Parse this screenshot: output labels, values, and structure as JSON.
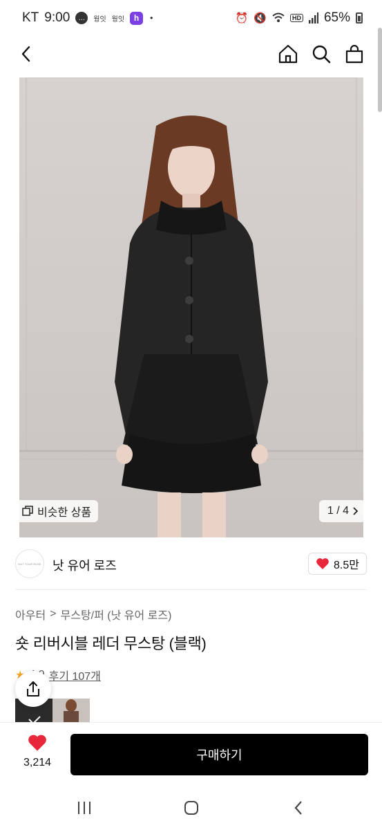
{
  "status_bar": {
    "carrier": "KT",
    "time": "9:00",
    "notif_text_1": "웡잇",
    "notif_text_2": "웡잇",
    "notif_app_letter": "h",
    "dot": "•",
    "battery": "65%"
  },
  "header": {
    "back_icon": "chevron-left-icon",
    "home_icon": "home-icon",
    "search_icon": "search-icon",
    "bag_icon": "shopping-bag-icon"
  },
  "gallery": {
    "similar_label": "비슷한 상품",
    "page_indicator": "1 / 4"
  },
  "brand": {
    "logo_text": "NOT YOUR ROSE",
    "name": "낫 유어 로즈",
    "likes": "8.5만"
  },
  "product": {
    "breadcrumb": [
      "아우터",
      "무스탕/퍼 (낫 유어 로즈)"
    ],
    "title": "숏 리버시블 레더 무스탕 (블랙)",
    "rating": "4.9",
    "reviews": "후기 107개"
  },
  "bottom": {
    "wish_count": "3,214",
    "buy_label": "구매하기"
  },
  "colors": {
    "accent_red": "#e8283a",
    "primary_black": "#000000"
  }
}
